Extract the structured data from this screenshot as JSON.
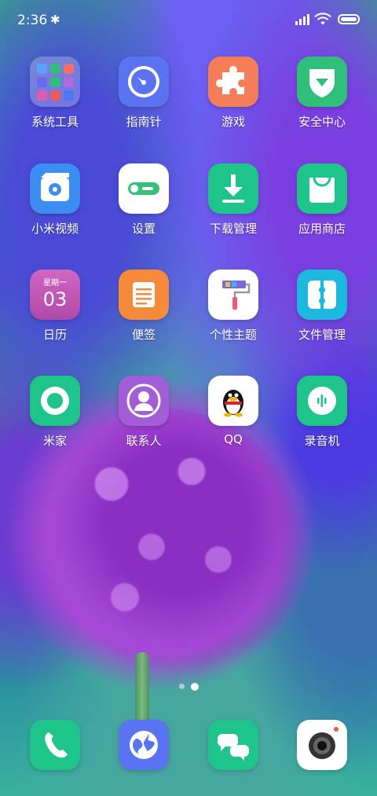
{
  "status_bar": {
    "time": "2:36",
    "bluetooth_icon": "bluetooth-icon",
    "signal_icon": "signal-icon",
    "wifi_icon": "wifi-icon",
    "battery_icon": "battery-icon"
  },
  "apps": [
    {
      "label": "系统工具",
      "icon": "folder-system-tools-icon"
    },
    {
      "label": "指南针",
      "icon": "compass-icon"
    },
    {
      "label": "游戏",
      "icon": "puzzle-icon"
    },
    {
      "label": "安全中心",
      "icon": "shield-icon"
    },
    {
      "label": "小米视频",
      "icon": "video-icon"
    },
    {
      "label": "设置",
      "icon": "settings-toggle-icon"
    },
    {
      "label": "下载管理",
      "icon": "download-icon"
    },
    {
      "label": "应用商店",
      "icon": "shopping-bag-icon"
    },
    {
      "label": "日历",
      "icon": "calendar-icon",
      "calendar_weekday": "星期一",
      "calendar_day": "03"
    },
    {
      "label": "便签",
      "icon": "notes-icon"
    },
    {
      "label": "个性主题",
      "icon": "paint-roller-icon"
    },
    {
      "label": "文件管理",
      "icon": "file-manager-icon"
    },
    {
      "label": "米家",
      "icon": "mijia-ring-icon"
    },
    {
      "label": "联系人",
      "icon": "contacts-icon"
    },
    {
      "label": "QQ",
      "icon": "qq-penguin-icon"
    },
    {
      "label": "录音机",
      "icon": "recorder-icon"
    }
  ],
  "pager": {
    "pages": 2,
    "active": 2
  },
  "dock": [
    {
      "icon": "phone-icon"
    },
    {
      "icon": "browser-globe-icon"
    },
    {
      "icon": "messages-icon"
    },
    {
      "icon": "camera-icon"
    }
  ],
  "colors": {
    "compass": "#5a73f0",
    "game": "#f37e58",
    "security": "#2fbf7a",
    "video": "#3c8df2",
    "settings": "#34c07a",
    "download": "#1fc48a",
    "appstore": "#1fc48a",
    "calendar": "#c45ab0",
    "notes": "#f58a3a",
    "theme": "#ffffff",
    "files": "#1cb8e0",
    "mijia": "#1fc48a",
    "contacts": "#a25ed6",
    "recorder": "#1fc48a",
    "phone": "#1fc48a",
    "browser": "#5a73f0",
    "messages": "#1fc48a",
    "camera": "#ffffff"
  }
}
